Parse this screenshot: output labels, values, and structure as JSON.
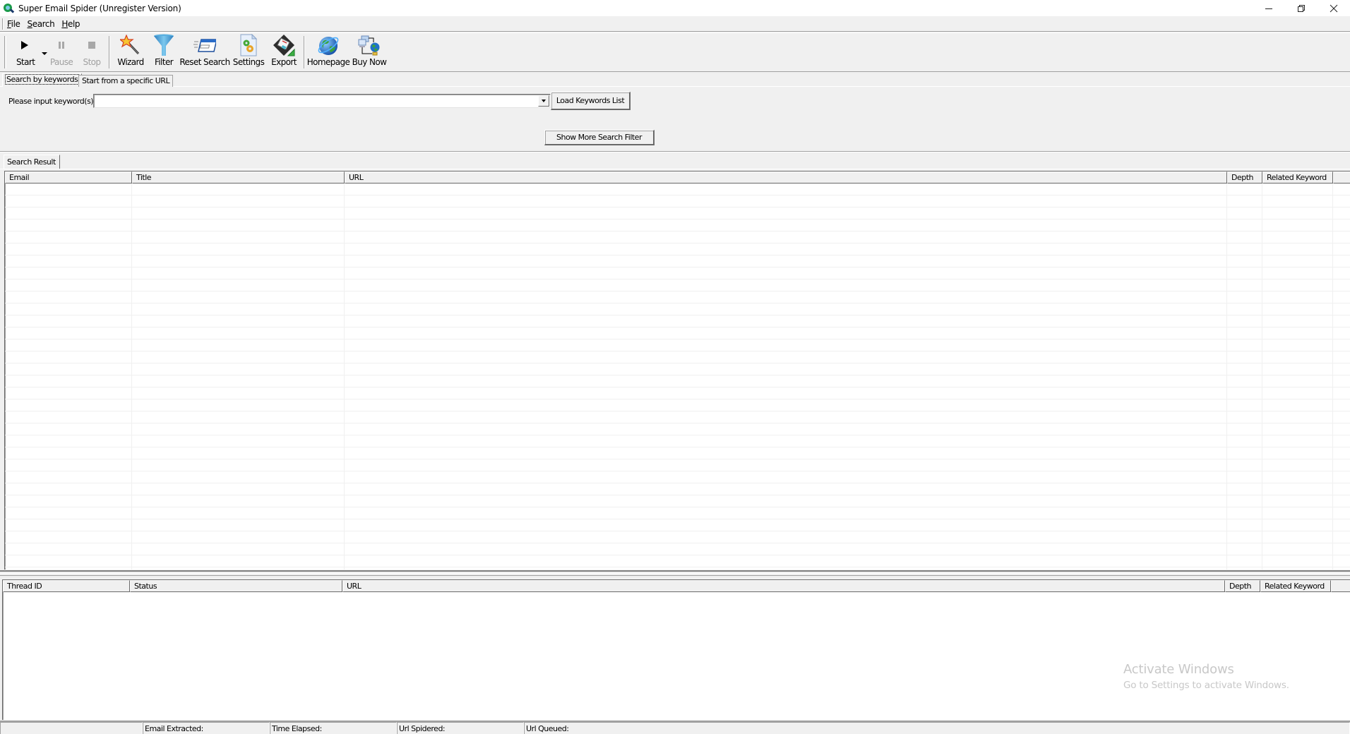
{
  "window": {
    "title": "Super Email Spider (Unregister Version)",
    "controls": {
      "minimize": "—",
      "restore": "❐",
      "close": "✕"
    }
  },
  "menu": {
    "items": [
      {
        "label": "File",
        "accel": "F",
        "rest": "ile"
      },
      {
        "label": "Search",
        "accel": "S",
        "rest": "earch"
      },
      {
        "label": "Help",
        "accel": "H",
        "rest": "elp"
      }
    ]
  },
  "toolbar": {
    "buttons": [
      {
        "id": "start",
        "label": "Start",
        "icon": "play-icon",
        "enabled": true
      },
      {
        "id": "pause",
        "label": "Pause",
        "icon": "pause-icon",
        "enabled": false
      },
      {
        "id": "stop",
        "label": "Stop",
        "icon": "stop-icon",
        "enabled": false
      },
      {
        "id": "wizard",
        "label": "Wizard",
        "icon": "magic-wand-icon",
        "enabled": true
      },
      {
        "id": "filter",
        "label": "Filter",
        "icon": "funnel-icon",
        "enabled": true
      },
      {
        "id": "reset",
        "label": "Reset Search",
        "icon": "window-reset-icon",
        "enabled": true
      },
      {
        "id": "settings",
        "label": "Settings",
        "icon": "settings-gear-icon",
        "enabled": true
      },
      {
        "id": "export",
        "label": "Export",
        "icon": "floppy-disk-icon",
        "enabled": true
      },
      {
        "id": "homepage",
        "label": "Homepage",
        "icon": "globe-icon",
        "enabled": true
      },
      {
        "id": "buynow",
        "label": "Buy Now",
        "icon": "network-globe-icon",
        "enabled": true
      }
    ]
  },
  "search_tabs": [
    {
      "label": "Search by keywords",
      "active": true
    },
    {
      "label": "Start from a specific URL",
      "active": false
    }
  ],
  "keyword_search": {
    "label": "Please input keyword(s):",
    "value": "",
    "placeholder": "",
    "load_button": "Load Keywords List",
    "more_filter_button": "Show More Search Filter"
  },
  "results": {
    "tab_label": "Search Result",
    "columns": [
      "Email",
      "Title",
      "URL",
      "Depth",
      "Related Keyword"
    ],
    "rows": []
  },
  "threads": {
    "columns": [
      "Thread ID",
      "Status",
      "URL",
      "Depth",
      "Related Keyword"
    ],
    "rows": []
  },
  "statusbar": {
    "panels": [
      {
        "label": ""
      },
      {
        "label": "Email Extracted:"
      },
      {
        "label": "Time Elapsed:"
      },
      {
        "label": "Url Spidered:"
      },
      {
        "label": "Url Queued:"
      }
    ]
  },
  "watermark": {
    "line1": "Activate Windows",
    "line2": "Go to Settings to activate Windows."
  }
}
